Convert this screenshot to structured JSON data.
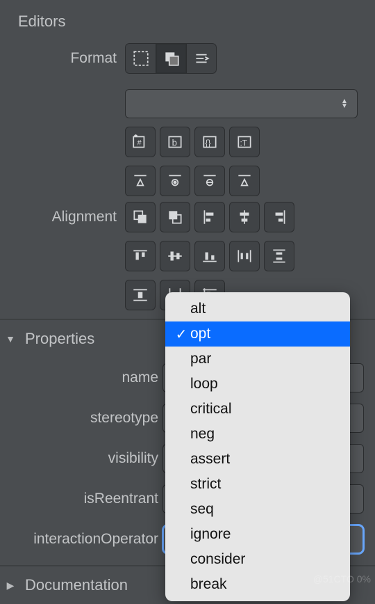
{
  "editors": {
    "title": "Editors"
  },
  "format": {
    "label": "Format",
    "dropdown_value": "",
    "buttons": [
      {
        "name": "marquee-select-icon",
        "selected": false
      },
      {
        "name": "overlap-icon",
        "selected": true
      },
      {
        "name": "text-align-icon",
        "selected": false
      }
    ],
    "tool_row": [
      {
        "name": "add-field-icon"
      },
      {
        "name": "type-frame-icon"
      },
      {
        "name": "braces-icon"
      },
      {
        "name": "text-box-icon"
      }
    ],
    "transform_row": [
      {
        "name": "transform-a-icon"
      },
      {
        "name": "transform-gear-icon"
      },
      {
        "name": "transform-swap-icon"
      },
      {
        "name": "transform-b-icon"
      }
    ]
  },
  "alignment": {
    "label": "Alignment",
    "rows": [
      [
        {
          "name": "send-back-icon"
        },
        {
          "name": "bring-front-icon"
        },
        {
          "name": "align-left-icon"
        },
        {
          "name": "align-center-icon"
        },
        {
          "name": "align-right-icon"
        }
      ],
      [
        {
          "name": "align-top-icon"
        },
        {
          "name": "align-middle-icon"
        },
        {
          "name": "align-bottom-icon"
        },
        {
          "name": "distribute-h-icon"
        },
        {
          "name": "distribute-v-icon"
        }
      ],
      [
        {
          "name": "hstack-icon"
        },
        {
          "name": "vstack-icon"
        },
        {
          "name": "grid-align-icon"
        }
      ]
    ]
  },
  "properties": {
    "title": "Properties",
    "fields": {
      "name": {
        "label": "name",
        "value": ""
      },
      "stereotype": {
        "label": "stereotype",
        "value": ""
      },
      "visibility": {
        "label": "visibility",
        "value": ""
      },
      "isReentrant": {
        "label": "isReentrant",
        "value": ""
      },
      "interactionOperator": {
        "label": "interactionOperator",
        "value": "opt"
      }
    }
  },
  "documentation": {
    "title": "Documentation"
  },
  "interactionOperator_menu": {
    "selected": "opt",
    "options": [
      "alt",
      "opt",
      "par",
      "loop",
      "critical",
      "neg",
      "assert",
      "strict",
      "seq",
      "ignore",
      "consider",
      "break"
    ]
  },
  "watermark": "@51CTO 0%"
}
